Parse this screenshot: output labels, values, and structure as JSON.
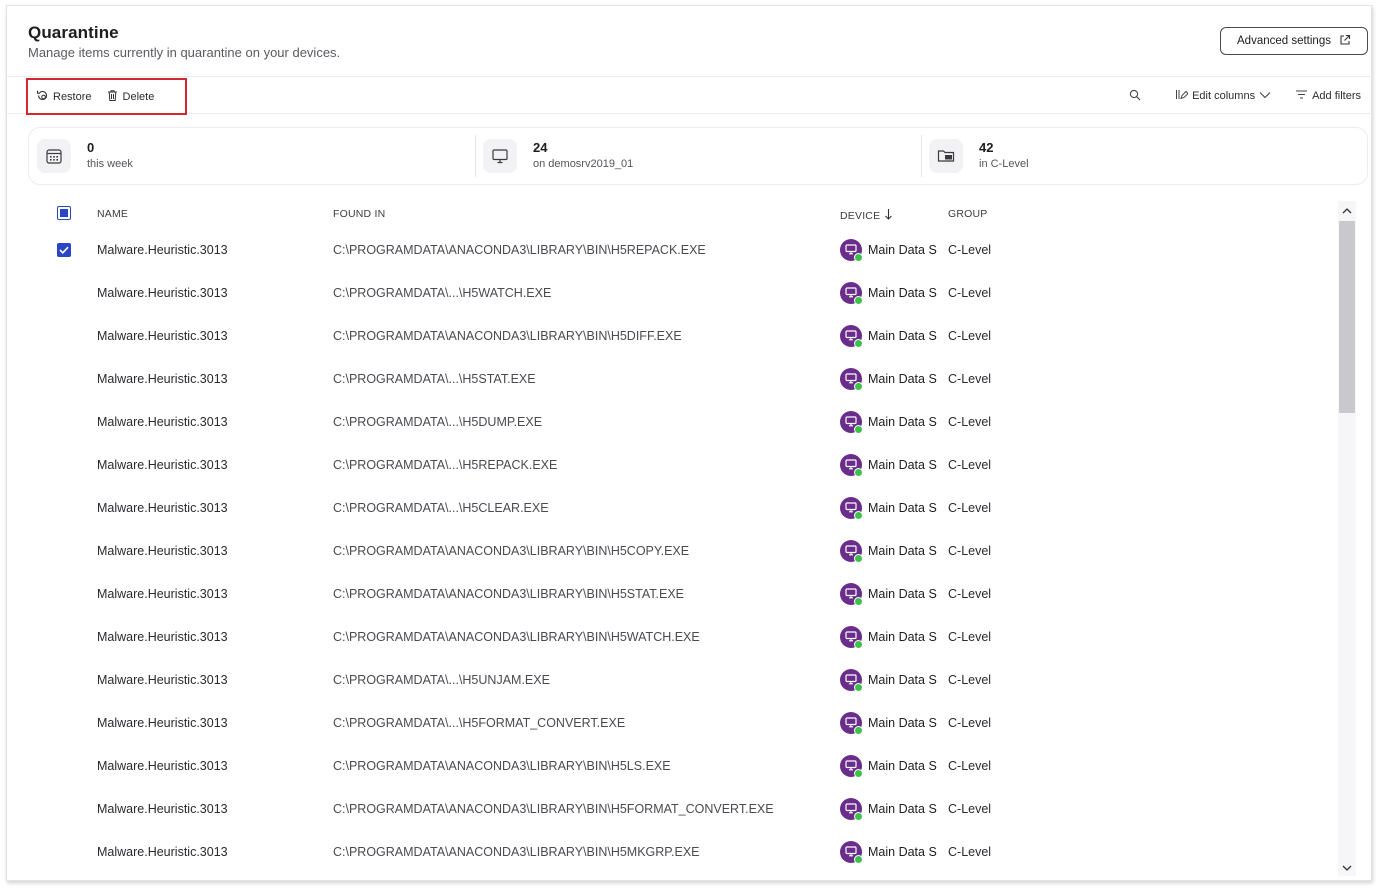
{
  "header": {
    "title": "Quarantine",
    "subtitle": "Manage items currently in quarantine on your devices.",
    "advanced_settings_label": "Advanced settings"
  },
  "toolbar": {
    "restore_label": "Restore",
    "delete_label": "Delete",
    "edit_columns_label": "Edit columns",
    "add_filters_label": "Add filters"
  },
  "stats": [
    {
      "value": "0",
      "label": "this week",
      "icon": "calendar-icon"
    },
    {
      "value": "24",
      "label": "on demosrv2019_01",
      "icon": "monitor-icon"
    },
    {
      "value": "42",
      "label": "in C-Level",
      "icon": "folder-monitor-icon"
    }
  ],
  "table": {
    "columns": {
      "name": "NAME",
      "found_in": "FOUND IN",
      "device": "DEVICE",
      "group": "GROUP"
    },
    "sort": {
      "column": "device",
      "direction": "descending"
    },
    "header_checkbox": "partial",
    "rows": [
      {
        "name": "Malware.Heuristic.3013",
        "found_in": "C:\\PROGRAMDATA\\ANACONDA3\\LIBRARY\\BIN\\H5REPACK.EXE",
        "device": "Main Data S",
        "group": "C-Level",
        "checked": true
      },
      {
        "name": "Malware.Heuristic.3013",
        "found_in": "C:\\PROGRAMDATA\\...\\H5WATCH.EXE",
        "device": "Main Data S",
        "group": "C-Level",
        "checked": false
      },
      {
        "name": "Malware.Heuristic.3013",
        "found_in": "C:\\PROGRAMDATA\\ANACONDA3\\LIBRARY\\BIN\\H5DIFF.EXE",
        "device": "Main Data S",
        "group": "C-Level",
        "checked": false
      },
      {
        "name": "Malware.Heuristic.3013",
        "found_in": "C:\\PROGRAMDATA\\...\\H5STAT.EXE",
        "device": "Main Data S",
        "group": "C-Level",
        "checked": false
      },
      {
        "name": "Malware.Heuristic.3013",
        "found_in": "C:\\PROGRAMDATA\\...\\H5DUMP.EXE",
        "device": "Main Data S",
        "group": "C-Level",
        "checked": false
      },
      {
        "name": "Malware.Heuristic.3013",
        "found_in": "C:\\PROGRAMDATA\\...\\H5REPACK.EXE",
        "device": "Main Data S",
        "group": "C-Level",
        "checked": false
      },
      {
        "name": "Malware.Heuristic.3013",
        "found_in": "C:\\PROGRAMDATA\\...\\H5CLEAR.EXE",
        "device": "Main Data S",
        "group": "C-Level",
        "checked": false
      },
      {
        "name": "Malware.Heuristic.3013",
        "found_in": "C:\\PROGRAMDATA\\ANACONDA3\\LIBRARY\\BIN\\H5COPY.EXE",
        "device": "Main Data S",
        "group": "C-Level",
        "checked": false
      },
      {
        "name": "Malware.Heuristic.3013",
        "found_in": "C:\\PROGRAMDATA\\ANACONDA3\\LIBRARY\\BIN\\H5STAT.EXE",
        "device": "Main Data S",
        "group": "C-Level",
        "checked": false
      },
      {
        "name": "Malware.Heuristic.3013",
        "found_in": "C:\\PROGRAMDATA\\ANACONDA3\\LIBRARY\\BIN\\H5WATCH.EXE",
        "device": "Main Data S",
        "group": "C-Level",
        "checked": false
      },
      {
        "name": "Malware.Heuristic.3013",
        "found_in": "C:\\PROGRAMDATA\\...\\H5UNJAM.EXE",
        "device": "Main Data S",
        "group": "C-Level",
        "checked": false
      },
      {
        "name": "Malware.Heuristic.3013",
        "found_in": "C:\\PROGRAMDATA\\...\\H5FORMAT_CONVERT.EXE",
        "device": "Main Data S",
        "group": "C-Level",
        "checked": false
      },
      {
        "name": "Malware.Heuristic.3013",
        "found_in": "C:\\PROGRAMDATA\\ANACONDA3\\LIBRARY\\BIN\\H5LS.EXE",
        "device": "Main Data S",
        "group": "C-Level",
        "checked": false
      },
      {
        "name": "Malware.Heuristic.3013",
        "found_in": "C:\\PROGRAMDATA\\ANACONDA3\\LIBRARY\\BIN\\H5FORMAT_CONVERT.EXE",
        "device": "Main Data S",
        "group": "C-Level",
        "checked": false
      },
      {
        "name": "Malware.Heuristic.3013",
        "found_in": "C:\\PROGRAMDATA\\ANACONDA3\\LIBRARY\\BIN\\H5MKGRP.EXE",
        "device": "Main Data S",
        "group": "C-Level",
        "checked": false
      }
    ]
  },
  "colors": {
    "accent": "#2a46c6",
    "device_icon": "#6b2d8b",
    "status_online": "#3ec14a",
    "highlight_box": "#d3282f"
  }
}
